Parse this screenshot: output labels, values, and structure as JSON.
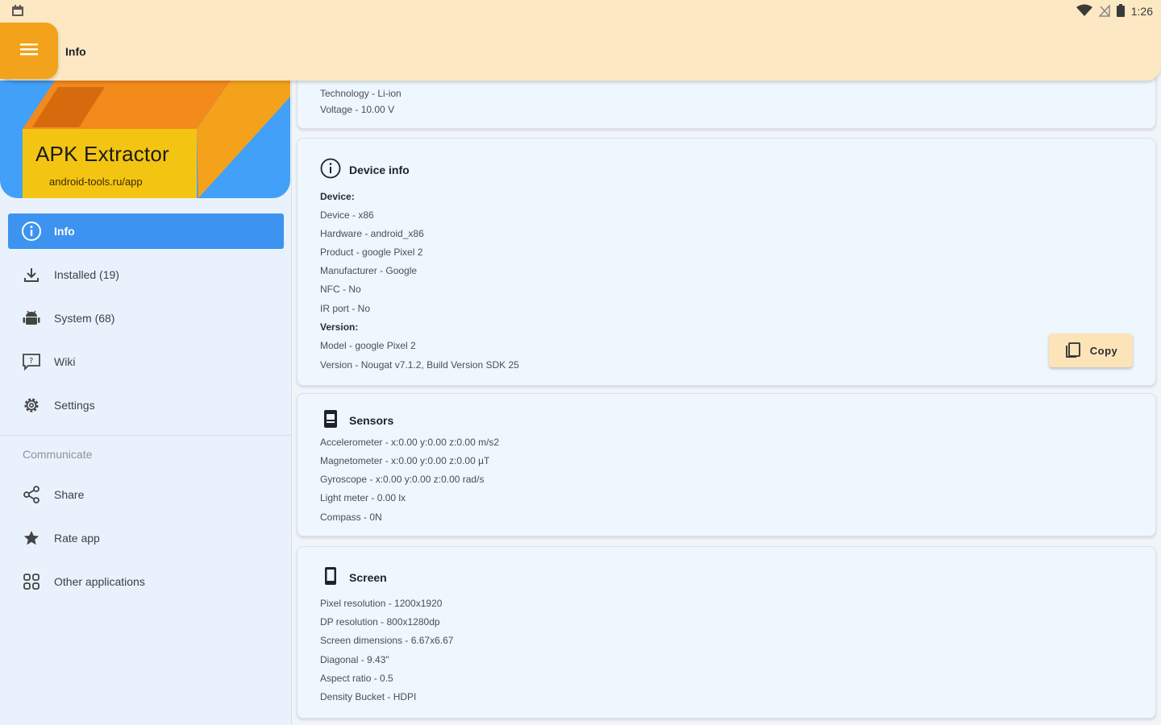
{
  "statusbar": {
    "time": "1:26"
  },
  "appbar": {
    "title": "Info"
  },
  "banner": {
    "title": "APK Extractor",
    "url": "android-tools.ru/app"
  },
  "nav": {
    "items": [
      {
        "label": "Info",
        "icon": "info-icon"
      },
      {
        "label": "Installed (19)",
        "icon": "download-icon"
      },
      {
        "label": "System (68)",
        "icon": "android-icon"
      },
      {
        "label": "Wiki",
        "icon": "wiki-icon"
      },
      {
        "label": "Settings",
        "icon": "gear-icon"
      }
    ],
    "section": "Communicate",
    "communicate": [
      {
        "label": "Share",
        "icon": "share-icon"
      },
      {
        "label": "Rate app",
        "icon": "star-icon"
      },
      {
        "label": "Other applications",
        "icon": "apps-icon"
      }
    ]
  },
  "battery": {
    "lines": [
      "Technology - Li-ion",
      "Voltage - 10.00 V"
    ]
  },
  "device": {
    "title": "Device info",
    "device_label": "Device:",
    "device_lines": [
      "Device - x86",
      "Hardware - android_x86",
      "Product - google Pixel 2",
      "Manufacturer - Google",
      "NFC - No",
      "IR port - No"
    ],
    "version_label": "Version:",
    "version_lines": [
      "Model - google Pixel 2",
      "Version - Nougat v7.1.2, Build Version SDK 25"
    ],
    "copy_label": "Copy"
  },
  "sensors": {
    "title": "Sensors",
    "lines": [
      "Accelerometer - x:0.00 y:0.00 z:0.00 m/s2",
      "Magnetometer - x:0.00 y:0.00 z:0.00 µT",
      "Gyroscope - x:0.00 y:0.00 z:0.00 rad/s",
      "Light meter - 0.00 lx",
      "Compass - 0N"
    ]
  },
  "screen": {
    "title": "Screen",
    "lines": [
      "Pixel resolution - 1200x1920",
      "DP resolution - 800x1280dp",
      "Screen dimensions - 6.67x6.67",
      "Diagonal - 9.43\"",
      "Aspect ratio - 0.5",
      "Density Bucket - HDPI"
    ]
  },
  "colors": {
    "accent": "#3d93f0",
    "appbar": "#fde8c4",
    "menu_button": "#f2a31b"
  }
}
